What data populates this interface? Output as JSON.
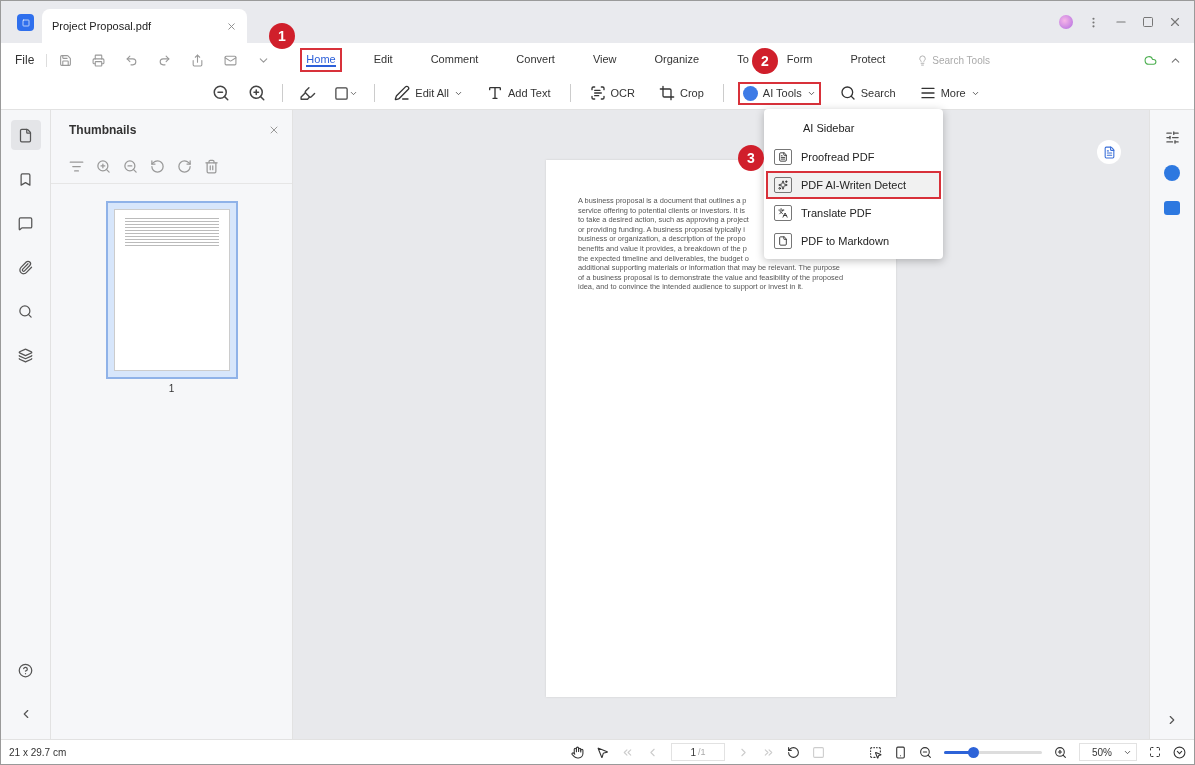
{
  "window": {
    "tab_title": "Project Proposal.pdf"
  },
  "menu": {
    "file": "File",
    "tabs": [
      {
        "label": "Home",
        "selected": true,
        "highlighted": true
      },
      {
        "label": "Edit",
        "selected": false,
        "highlighted": false
      },
      {
        "label": "Comment",
        "selected": false,
        "highlighted": false
      },
      {
        "label": "Convert",
        "selected": false,
        "highlighted": false
      },
      {
        "label": "View",
        "selected": false,
        "highlighted": false
      },
      {
        "label": "Organize",
        "selected": false,
        "highlighted": false
      },
      {
        "label": "To",
        "selected": false,
        "highlighted": false
      },
      {
        "label": "Form",
        "selected": false,
        "highlighted": false
      },
      {
        "label": "Protect",
        "selected": false,
        "highlighted": false
      }
    ],
    "search_placeholder": "Search Tools"
  },
  "toolbar": [
    {
      "label": "Edit All",
      "dropdown": true,
      "highlighted": false
    },
    {
      "label": "Add Text",
      "dropdown": false,
      "highlighted": false
    },
    {
      "label": "OCR",
      "dropdown": false,
      "highlighted": false
    },
    {
      "label": "Crop",
      "dropdown": false,
      "highlighted": false
    },
    {
      "label": "AI Tools",
      "dropdown": true,
      "highlighted": true
    },
    {
      "label": "Search",
      "dropdown": false,
      "highlighted": false
    },
    {
      "label": "More",
      "dropdown": true,
      "highlighted": false
    }
  ],
  "thumbnails": {
    "title": "Thumbnails",
    "pages": [
      {
        "label": "1",
        "selected": true
      }
    ]
  },
  "document": {
    "lines": [
      "A business proposal is a document that outlines a p",
      "service offering to potential clients or investors. It is",
      "to take a desired action, such as approving a project",
      "or providing funding. A business proposal typically i",
      "business or organization, a description of the propo",
      "benefits and value it provides, a breakdown of the p",
      "the expected timeline and deliverables, the budget o",
      "additional supporting materials or information that may be relevant. The purpose",
      "of a business proposal is to demonstrate the value and feasibility of the proposed",
      "idea, and to convince the intended audience to support or invest in it."
    ]
  },
  "dropdown": {
    "items": [
      {
        "label": "AI Sidebar",
        "highlighted": false
      },
      {
        "label": "Proofread PDF",
        "highlighted": false
      },
      {
        "label": "PDF AI-Writen Detect",
        "highlighted": true
      },
      {
        "label": "Translate PDF",
        "highlighted": false
      },
      {
        "label": "PDF to Markdown",
        "highlighted": false
      }
    ]
  },
  "callouts": [
    "1",
    "2",
    "3"
  ],
  "status_bar": {
    "page_size": "21 x 29.7 cm",
    "page": "1",
    "page_total": "/1",
    "zoom": "50%",
    "zoom_slider": {
      "level": 0.3
    }
  }
}
